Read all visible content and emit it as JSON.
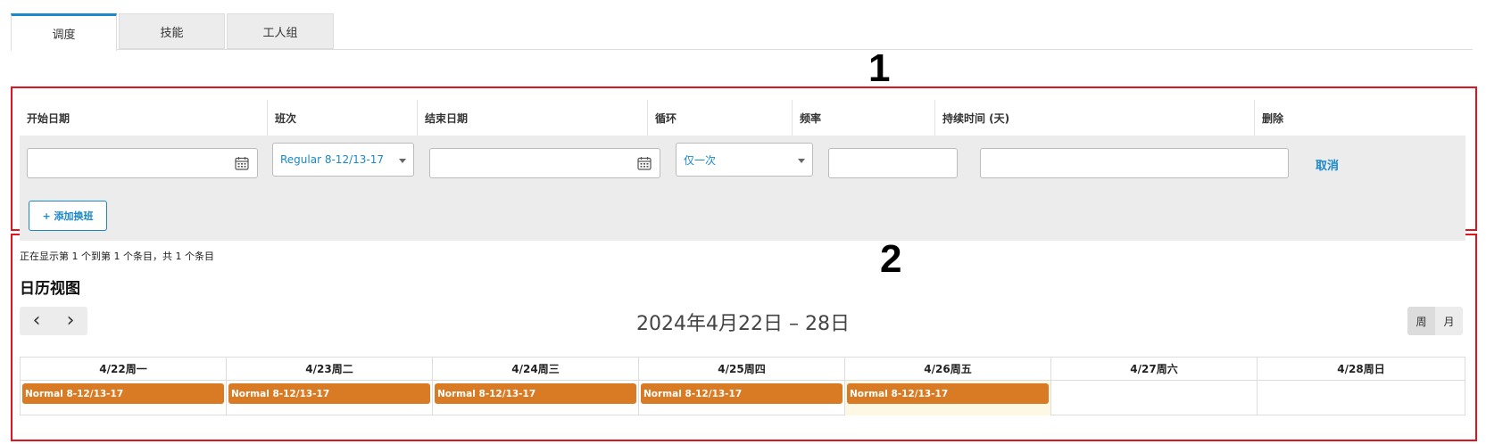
{
  "tabs": [
    {
      "label": "调度",
      "active": true
    },
    {
      "label": "技能",
      "active": false
    },
    {
      "label": "工人组",
      "active": false
    }
  ],
  "annotations": {
    "marker_1": "1",
    "marker_2": "2",
    "box_color": "#e0141e"
  },
  "schedule": {
    "columns": [
      "开始日期",
      "班次",
      "结束日期",
      "循环",
      "频率",
      "持续时间 (天)",
      "删除"
    ],
    "row": {
      "start_date": "",
      "shift": "Regular 8-12/13-17",
      "end_date": "",
      "recurrence": "仅一次",
      "frequency": "",
      "duration": "",
      "delete_label": "取消"
    },
    "add_shift_label": "+ 添加换班",
    "icons": {
      "calendar": "calendar-icon",
      "dropdown": "chevron-down-icon"
    }
  },
  "results_info": "正在显示第 1 个到第 1 个条目，共 1 个条目",
  "calendar": {
    "title": "日历视图",
    "range": "2024年4月22日 – 28日",
    "prev_icon": "‹",
    "next_icon": "›",
    "views": [
      {
        "label": "周",
        "active": true
      },
      {
        "label": "月",
        "active": false
      }
    ],
    "days": [
      {
        "label": "4/22周一",
        "event": "Normal 8-12/13-17",
        "today": false
      },
      {
        "label": "4/23周二",
        "event": "Normal 8-12/13-17",
        "today": false
      },
      {
        "label": "4/24周三",
        "event": "Normal 8-12/13-17",
        "today": false
      },
      {
        "label": "4/25周四",
        "event": "Normal 8-12/13-17",
        "today": false
      },
      {
        "label": "4/26周五",
        "event": "Normal 8-12/13-17",
        "today": true
      },
      {
        "label": "4/27周六",
        "event": "",
        "today": false
      },
      {
        "label": "4/28周日",
        "event": "",
        "today": false
      }
    ],
    "event_color": "#d97b24"
  },
  "colors": {
    "accent": "#1a88c9",
    "tab_active_border": "#1a88c9"
  }
}
